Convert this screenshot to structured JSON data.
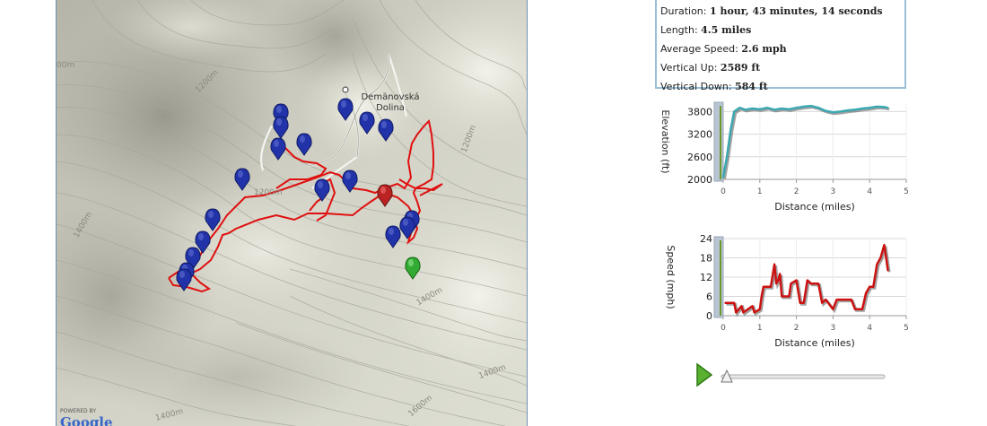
{
  "stats": {
    "duration_label": "Duration:",
    "duration_value": "1 hour, 43 minutes, 14 seconds",
    "length_label": "Length:",
    "length_value": "4.5 miles",
    "avg_speed_label": "Average Speed:",
    "avg_speed_value": "2.6 mph",
    "vert_up_label": "Vertical Up:",
    "vert_up_value": "2589 ft",
    "vert_down_label": "Vertical Down:",
    "vert_down_value": "584 ft"
  },
  "map": {
    "place_line1": "Demänovská",
    "place_line2": "Dolina",
    "contour_labels": [
      "00m",
      "1200m",
      "1200m",
      "1400m",
      "1400m",
      "1200m",
      "1400m",
      "1600m",
      "1400m"
    ],
    "brand_powered": "POWERED BY",
    "brand_logo": "Google",
    "colors": {
      "track": "#e01010",
      "marker_blue": "#2233aa",
      "marker_red": "#bb2222",
      "marker_green": "#33aa33"
    }
  },
  "chart_data": [
    {
      "type": "line",
      "ylabel": "Elevation (ft)",
      "xlabel": "Distance (miles)",
      "xlim": [
        0,
        5
      ],
      "ylim": [
        2000,
        4000
      ],
      "xticks": [
        "0",
        "1",
        "2",
        "3",
        "4",
        "5"
      ],
      "yticks": [
        "2000",
        "2600",
        "3200",
        "3800"
      ],
      "color": "#3aa8b0",
      "x": [
        0.0,
        0.1,
        0.2,
        0.3,
        0.45,
        0.6,
        0.8,
        1.0,
        1.2,
        1.4,
        1.6,
        1.8,
        2.0,
        2.2,
        2.4,
        2.6,
        2.8,
        3.0,
        3.2,
        3.4,
        3.6,
        3.8,
        4.0,
        4.2,
        4.4,
        4.5
      ],
      "y": [
        2050,
        2600,
        3300,
        3800,
        3900,
        3850,
        3880,
        3860,
        3900,
        3850,
        3880,
        3860,
        3900,
        3930,
        3950,
        3900,
        3820,
        3780,
        3800,
        3830,
        3850,
        3880,
        3900,
        3930,
        3920,
        3900
      ]
    },
    {
      "type": "line",
      "ylabel": "Speed (mph)",
      "xlabel": "Distance (miles)",
      "xlim": [
        0,
        5
      ],
      "ylim": [
        0,
        24
      ],
      "xticks": [
        "0",
        "1",
        "2",
        "3",
        "4",
        "5"
      ],
      "yticks": [
        "0",
        "6",
        "12",
        "18",
        "24"
      ],
      "color": "#cc1111",
      "x": [
        0.05,
        0.3,
        0.35,
        0.5,
        0.55,
        0.8,
        0.85,
        1.0,
        1.05,
        1.1,
        1.3,
        1.4,
        1.45,
        1.5,
        1.55,
        1.6,
        1.8,
        1.85,
        2.0,
        2.1,
        2.2,
        2.3,
        2.4,
        2.6,
        2.7,
        2.8,
        3.0,
        3.1,
        3.3,
        3.5,
        3.6,
        3.8,
        3.9,
        4.0,
        4.1,
        4.2,
        4.3,
        4.4,
        4.5
      ],
      "y": [
        4,
        4,
        1,
        3,
        1,
        3,
        1,
        2,
        6,
        9,
        9,
        16,
        10,
        11,
        13,
        6,
        6,
        10,
        11,
        4,
        4,
        11,
        10,
        10,
        4,
        5,
        2,
        5,
        5,
        5,
        2,
        2,
        7,
        9,
        9,
        16,
        18,
        22,
        14
      ]
    }
  ]
}
